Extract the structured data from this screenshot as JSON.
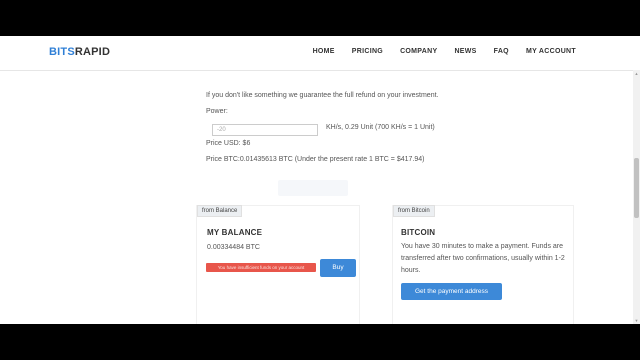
{
  "header": {
    "logo_part1": "BITS",
    "logo_part2": "RAPID",
    "nav": [
      "HOME",
      "PRICING",
      "COMPANY",
      "NEWS",
      "FAQ",
      "MY ACCOUNT"
    ]
  },
  "purchase": {
    "refund_text": "If you don't like something we guarantee the full refund on your investment.",
    "power_label": "Power:",
    "power_value": "-20",
    "power_unit_text": "KH/s, 0.29 Unit (700 KH/s = 1 Unit)",
    "price_usd": "Price USD: $6",
    "price_btc": "Price BTC:0.01435613 BTC (Under the present rate 1 BTC = $417.94)"
  },
  "balance_panel": {
    "tab": "from Balance",
    "title": "MY BALANCE",
    "amount": "0.00334484 BTC",
    "warning": "You have insufficient funds on your account",
    "buy_label": "Buy"
  },
  "bitcoin_panel": {
    "tab": "from Bitcoin",
    "title": "BITCOIN",
    "description_line1": "You have 30 minutes to make a payment. Funds are",
    "description_line2": "transferred after two confirmations, usually within 1-2",
    "description_line3": "hours.",
    "button_label": "Get the payment address"
  },
  "colors": {
    "accent": "#3d89d8",
    "logo_blue": "#2f7fd6",
    "warning_red": "#e8564b"
  }
}
